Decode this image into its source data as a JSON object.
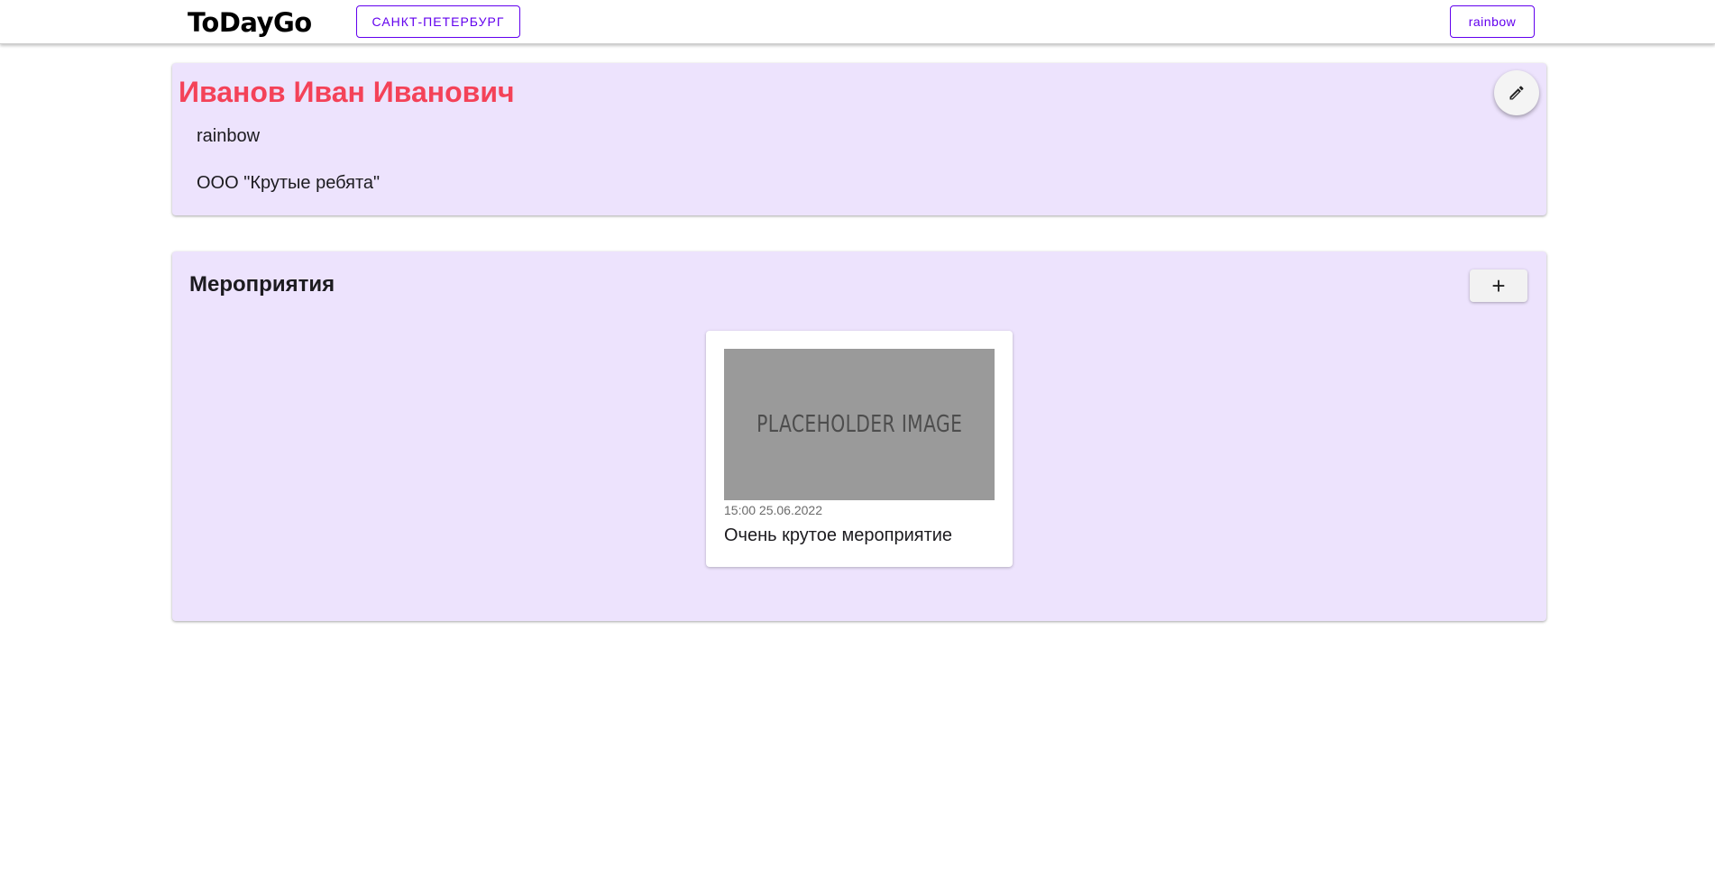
{
  "header": {
    "logo_text": "ToDayGo",
    "city_label": "САНКТ-ПЕТЕРБУРГ",
    "user_label": "rainbow",
    "accent_color": "#6200ee"
  },
  "profile": {
    "name": "Иванов Иван Иванович",
    "login": "rainbow",
    "company": "ООО \"Крутые ребята\"",
    "name_color": "#f44258",
    "edit_icon": "pencil-icon"
  },
  "events": {
    "title": "Мероприятия",
    "add_label": "+",
    "items": [
      {
        "image_text": "PLACEHOLDER IMAGE",
        "datetime": "15:00 25.06.2022",
        "title": "Очень крутое мероприятие"
      }
    ]
  }
}
